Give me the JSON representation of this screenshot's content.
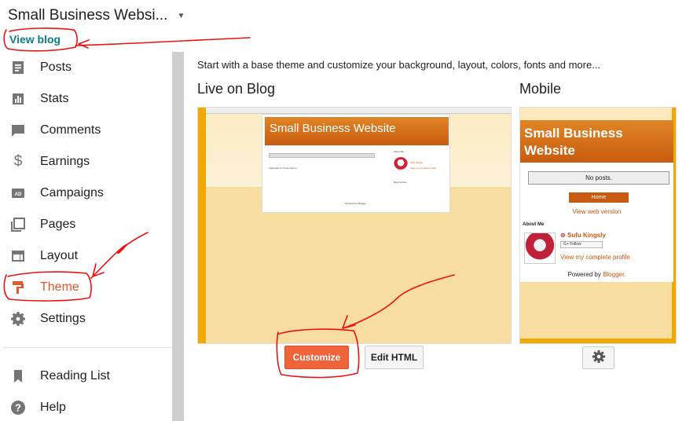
{
  "header": {
    "blog_name": "Small Business Websi...",
    "view_blog": "View blog"
  },
  "sidebar": {
    "items": [
      {
        "label": "Posts",
        "icon": "posts-icon"
      },
      {
        "label": "Stats",
        "icon": "stats-icon"
      },
      {
        "label": "Comments",
        "icon": "comments-icon"
      },
      {
        "label": "Earnings",
        "icon": "earnings-icon"
      },
      {
        "label": "Campaigns",
        "icon": "campaigns-icon"
      },
      {
        "label": "Pages",
        "icon": "pages-icon"
      },
      {
        "label": "Layout",
        "icon": "layout-icon"
      },
      {
        "label": "Theme",
        "icon": "theme-icon",
        "active": true
      },
      {
        "label": "Settings",
        "icon": "settings-icon"
      },
      {
        "label": "Reading List",
        "icon": "reading-list-icon"
      },
      {
        "label": "Help",
        "icon": "help-icon"
      }
    ]
  },
  "main": {
    "description": "Start with a base theme and customize your background, layout, colors, fonts and more...",
    "live_title": "Live on Blog",
    "mobile_title": "Mobile",
    "customize_label": "Customize",
    "edit_html_label": "Edit HTML",
    "preview": {
      "blog_title": "Small Business Website",
      "mobile_blog_title": "Small Business Website",
      "no_posts": "No posts.",
      "home": "Home",
      "view_web_version": "View web version",
      "about_me": "About Me",
      "profile_name": "Sufu Kingsly",
      "follow": "Follow",
      "view_profile": "View my complete profile",
      "powered_by": "Powered by",
      "blogger": "Blogger."
    }
  },
  "colors": {
    "accent": "#e3572d",
    "link": "#0e7c86",
    "button": "#f0643c",
    "annotation": "#e11"
  }
}
